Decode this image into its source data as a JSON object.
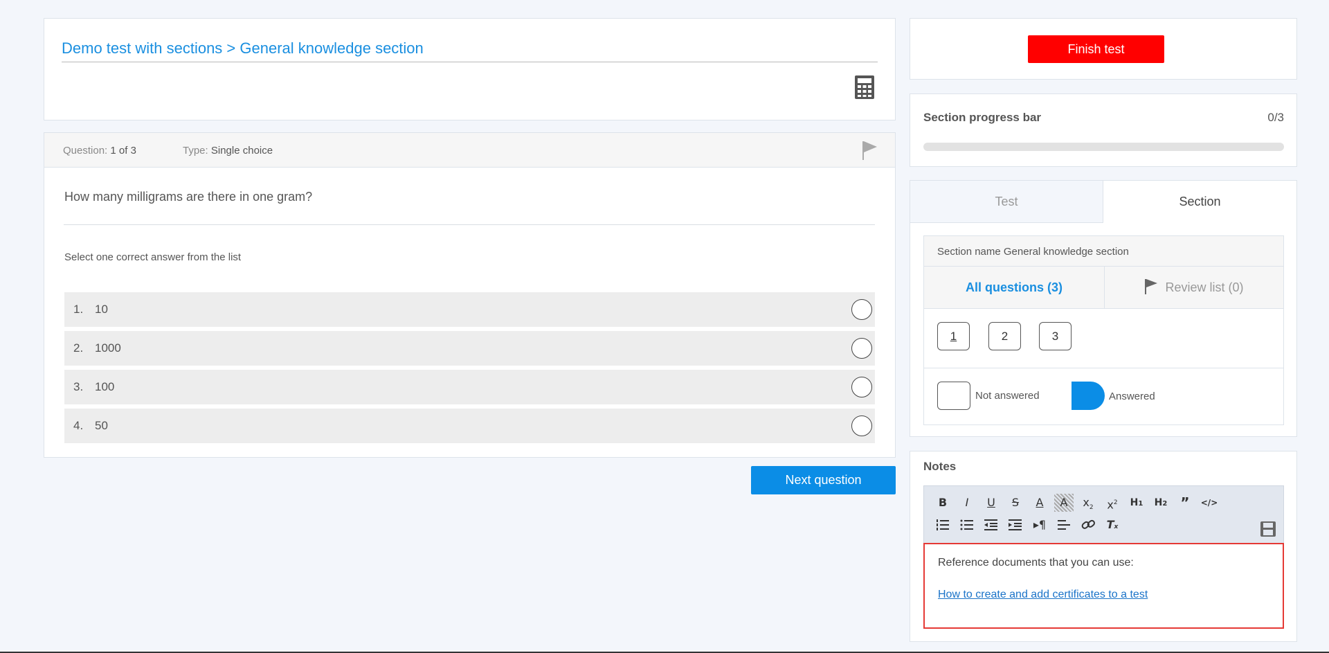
{
  "header": {
    "breadcrumb": "Demo test with sections > General knowledge section"
  },
  "question": {
    "number_label": "Question:",
    "number_value": "1 of 3",
    "type_label": "Type:",
    "type_value": "Single choice",
    "text": "How many milligrams are there in one gram?",
    "instruction": "Select one correct answer from the list",
    "options": [
      {
        "num": "1.",
        "value": "10"
      },
      {
        "num": "2.",
        "value": "1000"
      },
      {
        "num": "3.",
        "value": "100"
      },
      {
        "num": "4.",
        "value": "50"
      }
    ]
  },
  "buttons": {
    "next": "Next question",
    "finish": "Finish test"
  },
  "progress": {
    "label": "Section progress bar",
    "count": "0/3",
    "fraction": 0
  },
  "navigation": {
    "tabs": [
      "Test",
      "Section"
    ],
    "active_tab": "Section",
    "section_name": "Section name General knowledge section",
    "subtabs": {
      "all": "All questions (3)",
      "review": "Review list (0)"
    },
    "question_numbers": [
      "1",
      "2",
      "3"
    ],
    "current_question": "1",
    "legend": {
      "not_answered": "Not answered",
      "answered": "Answered"
    }
  },
  "notes": {
    "title": "Notes",
    "toolbar_icons": [
      "bold-icon",
      "italic-icon",
      "underline-icon",
      "strikethrough-icon",
      "text-color-icon",
      "highlight-icon",
      "subscript-icon",
      "superscript-icon",
      "heading1-icon",
      "heading2-icon",
      "quote-icon",
      "code-icon",
      "ordered-list-icon",
      "bullet-list-icon",
      "outdent-icon",
      "indent-icon",
      "text-direction-icon",
      "align-icon",
      "link-icon",
      "clear-format-icon",
      "save-icon"
    ],
    "body_text": "Reference documents that you can use:",
    "link_text": "How to create and add certificates to a test"
  },
  "colors": {
    "accent": "#0b8de6",
    "finish": "#ff0000",
    "highlight_border": "#e53935"
  }
}
